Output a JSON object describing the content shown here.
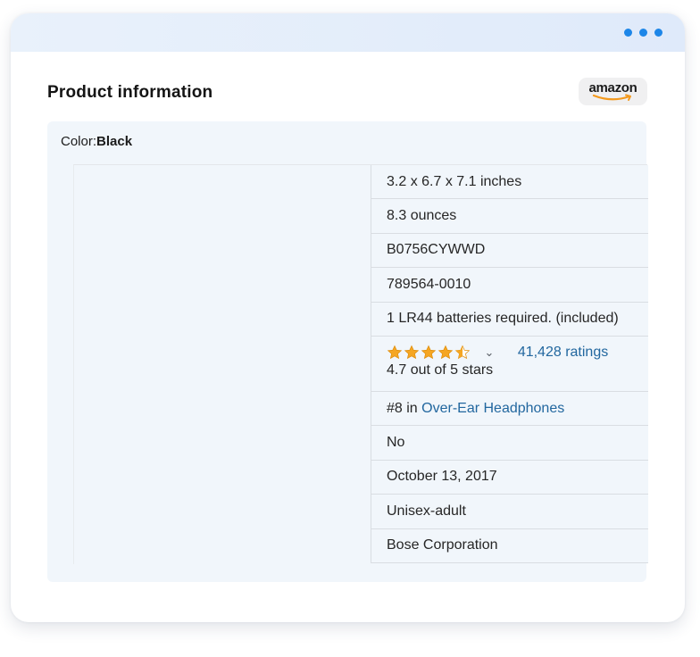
{
  "heading": "Product information",
  "brand_badge": "amazon",
  "color": {
    "label": "Color:",
    "value": "Black"
  },
  "specs": {
    "dimensions": "3.2 x 6.7 x 7.1 inches",
    "weight": "8.3 ounces",
    "asin": "B0756CYWWD",
    "model": "789564-0010",
    "batteries": "1 LR44 batteries required. (included)",
    "rating": {
      "stars_value": 4.7,
      "ratings_link": "41,428 ratings",
      "summary": "4.7 out of 5 stars"
    },
    "rank": {
      "prefix": "#8 in ",
      "category_link": "Over-Ear Headphones"
    },
    "discontinued": "No",
    "date": "October 13, 2017",
    "department": "Unisex-adult",
    "manufacturer": "Bose Corporation"
  },
  "colors": {
    "accent": "#1d86e8",
    "star": "#f5a623",
    "link": "#22679f",
    "panel": "#f1f6fb"
  },
  "icons": {
    "menu": "dots-menu-icon",
    "star": "star-icon",
    "chevron": "chevron-down-icon"
  }
}
